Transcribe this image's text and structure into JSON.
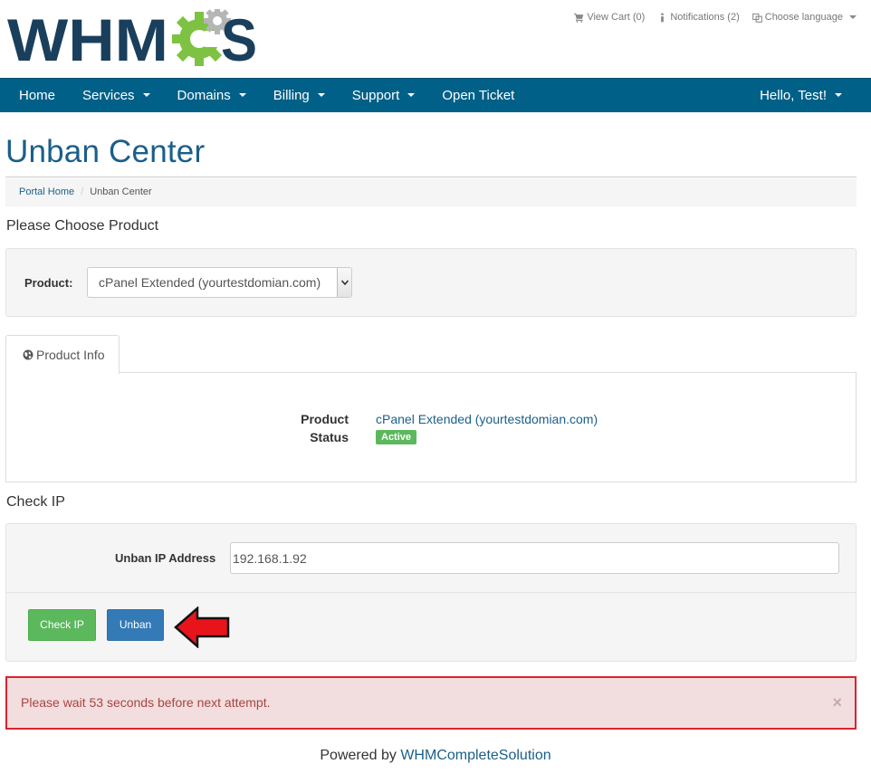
{
  "brand": {
    "logo_text_left": "WHM",
    "logo_text_right": "S",
    "logo_color": "#1a3f5c",
    "gear_color": "#7dc242"
  },
  "top_links": {
    "cart": "View Cart (0)",
    "notifications": "Notifications (2)",
    "language": "Choose language"
  },
  "navbar": {
    "color": "#006087",
    "items": [
      {
        "label": "Home"
      },
      {
        "label": "Services"
      },
      {
        "label": "Domains"
      },
      {
        "label": "Billing"
      },
      {
        "label": "Support"
      },
      {
        "label": "Open Ticket"
      }
    ],
    "user": "Hello, Test!"
  },
  "page": {
    "title": "Unban Center"
  },
  "breadcrumb": {
    "home": "Portal Home",
    "current": "Unban Center"
  },
  "product_section": {
    "heading": "Please Choose Product",
    "label": "Product:",
    "selected": "cPanel Extended (yourtestdomian.com)"
  },
  "product_info": {
    "tab_label": "Product Info",
    "product_label": "Product",
    "product_value": "cPanel Extended (yourtestdomian.com)",
    "status_label": "Status",
    "status_value": "Active",
    "status_color": "#5cb85c"
  },
  "check_ip": {
    "heading": "Check IP",
    "label": "Unban IP Address",
    "value": "192.168.1.92",
    "check_button": "Check IP",
    "unban_button": "Unban"
  },
  "alert": {
    "message": "Please wait 53 seconds before next attempt.",
    "close": "×"
  },
  "footer": {
    "prefix": "Powered by",
    "link": "WHMCompleteSolution"
  }
}
